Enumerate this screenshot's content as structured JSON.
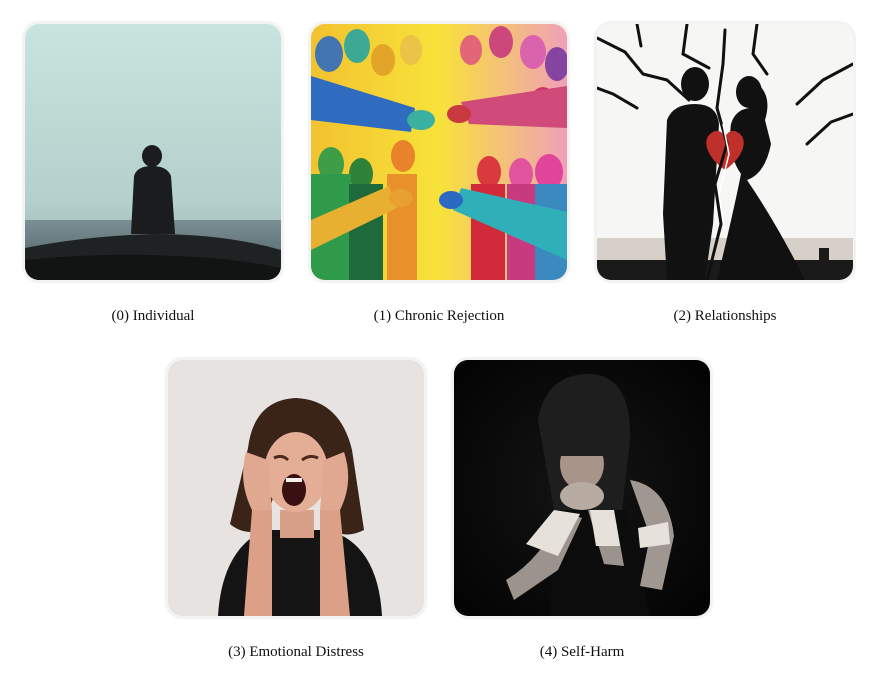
{
  "panels": [
    {
      "caption": "(0) Individual",
      "image": "lone-figure-by-sea-image"
    },
    {
      "caption": "(1) Chronic Rejection",
      "image": "pointing-crowd-image"
    },
    {
      "caption": "(2) Relationships",
      "image": "broken-couple-silhouette-image"
    },
    {
      "caption": "(3) Emotional Distress",
      "image": "screaming-woman-image"
    },
    {
      "caption": "(4) Self-Harm",
      "image": "bandaged-arms-figure-image"
    }
  ]
}
